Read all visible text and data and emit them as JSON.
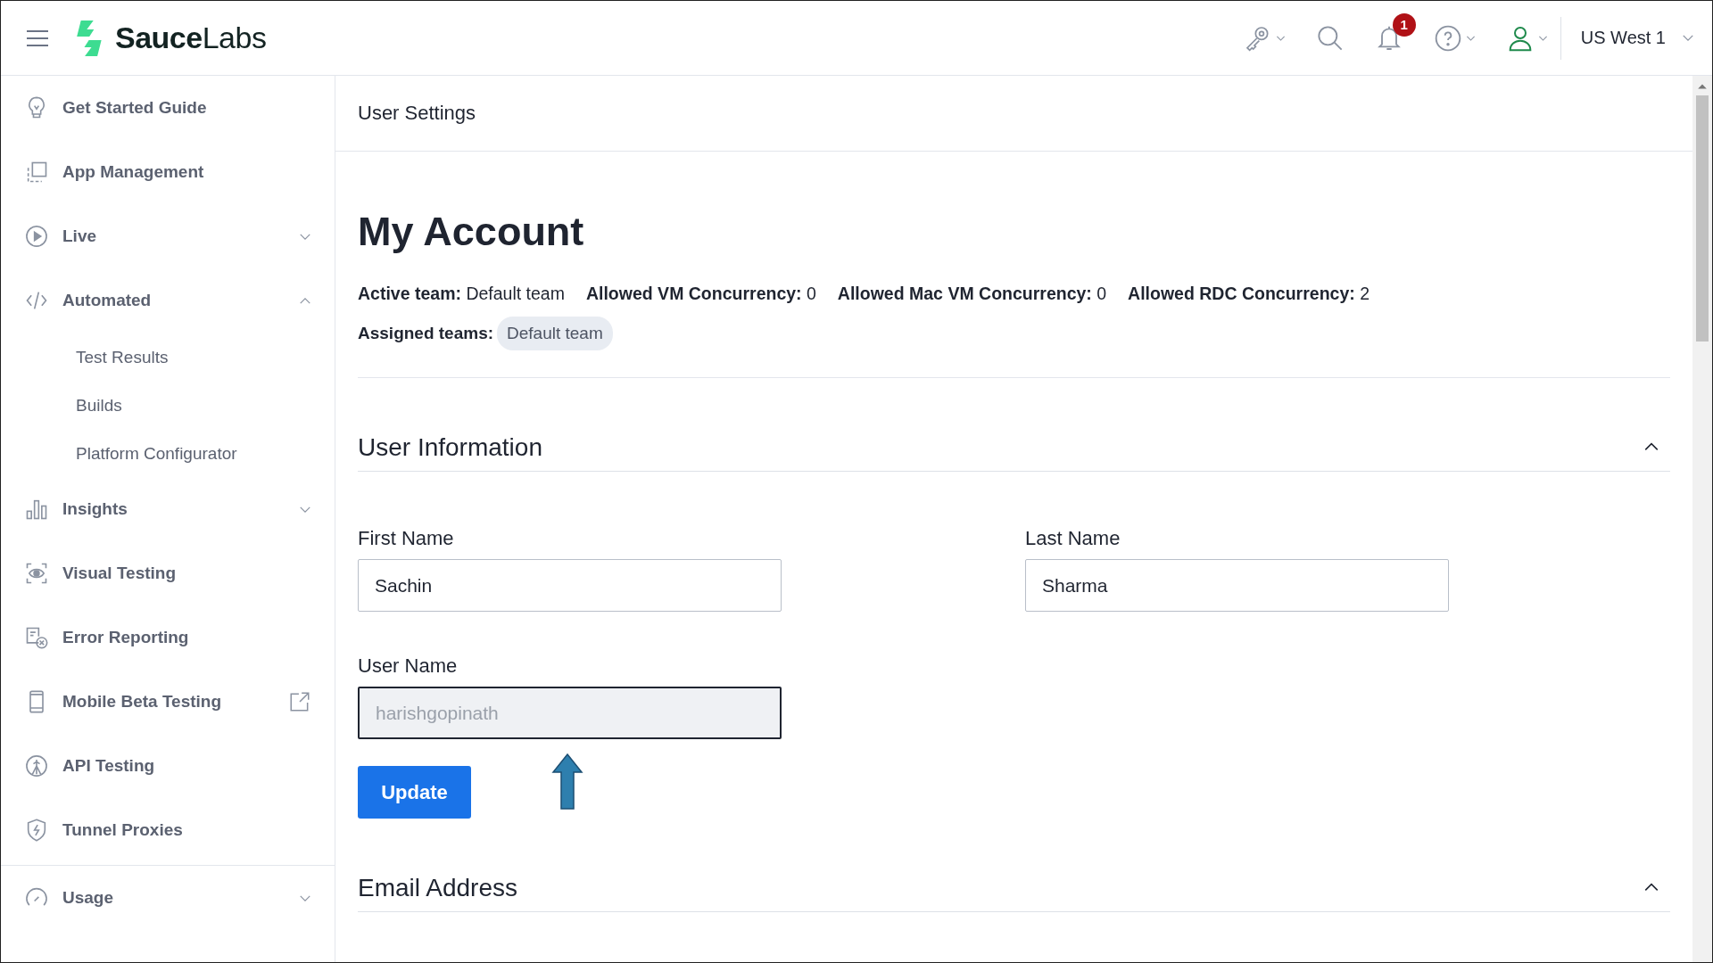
{
  "header": {
    "brand": {
      "bold": "Sauce",
      "light": "Labs"
    },
    "notifications_badge": "1",
    "region": "US West 1"
  },
  "sidebar": {
    "items": [
      {
        "label": "Get Started Guide",
        "external": false
      },
      {
        "label": "App Management",
        "external": false
      },
      {
        "label": "Live",
        "expanded": false,
        "external": false
      },
      {
        "label": "Automated",
        "expanded": true,
        "external": false,
        "children": [
          {
            "label": "Test Results"
          },
          {
            "label": "Builds"
          },
          {
            "label": "Platform Configurator"
          }
        ]
      },
      {
        "label": "Insights",
        "expanded": false,
        "external": false
      },
      {
        "label": "Visual Testing",
        "external": false
      },
      {
        "label": "Error Reporting",
        "external": false
      },
      {
        "label": "Mobile Beta Testing",
        "external": true
      },
      {
        "label": "API Testing",
        "external": false
      },
      {
        "label": "Tunnel Proxies",
        "external": false
      }
    ],
    "footer_items": [
      {
        "label": "Usage",
        "expanded": false,
        "external": false
      }
    ]
  },
  "page": {
    "breadcrumb": "User Settings",
    "title": "My Account",
    "stats": [
      {
        "label": "Active team:",
        "value": "Default team"
      },
      {
        "label": "Allowed VM Concurrency:",
        "value": "0"
      },
      {
        "label": "Allowed Mac VM Concurrency:",
        "value": "0"
      },
      {
        "label": "Allowed RDC Concurrency:",
        "value": "2"
      }
    ],
    "assigned_teams": {
      "label": "Assigned teams:",
      "teams": [
        "Default team"
      ]
    },
    "sections": [
      {
        "title": "User Information",
        "expanded": true,
        "fields": [
          {
            "label": "First Name",
            "value": "Sachin",
            "disabled": false,
            "focused": false
          },
          {
            "label": "Last Name",
            "value": "Sharma",
            "disabled": false,
            "focused": false
          },
          {
            "label": "User Name",
            "value": "harishgopinath",
            "disabled": true,
            "focused": true
          }
        ],
        "button": "Update"
      },
      {
        "title": "Email Address",
        "expanded": true
      }
    ]
  }
}
